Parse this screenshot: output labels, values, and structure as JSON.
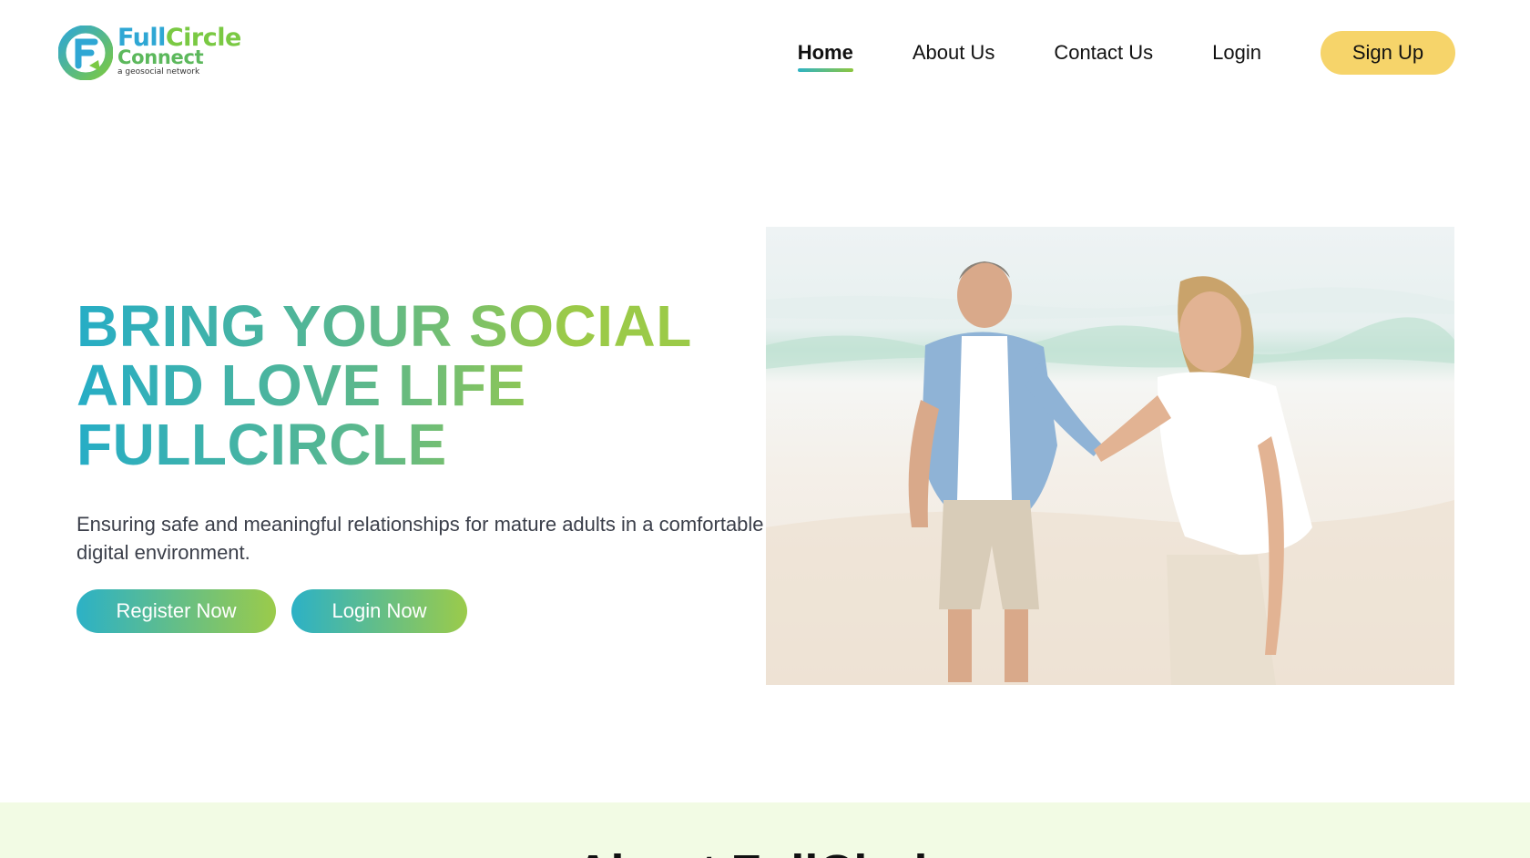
{
  "brand": {
    "name_part1": "Full",
    "name_part2": "Circle",
    "name_line2": "Connect",
    "tagline": "a geosocial network"
  },
  "nav": {
    "items": [
      {
        "label": "Home",
        "active": true
      },
      {
        "label": "About Us",
        "active": false
      },
      {
        "label": "Contact Us",
        "active": false
      },
      {
        "label": "Login",
        "active": false
      }
    ],
    "signup_label": "Sign Up"
  },
  "hero": {
    "title_lines": [
      "BRING YOUR SOCIAL",
      "AND LOVE LIFE",
      "FULLCIRCLE"
    ],
    "subtitle": "Ensuring safe and meaningful relationships for mature adults in a comfortable digital environment.",
    "register_label": "Register Now",
    "login_label": "Login Now"
  },
  "about": {
    "title": "About FullCircle"
  },
  "colors": {
    "gradient_start": "#2cb1c6",
    "gradient_end": "#9bcb4a",
    "signup_bg": "#f6d46a",
    "about_bg": "#f2fbe4"
  }
}
